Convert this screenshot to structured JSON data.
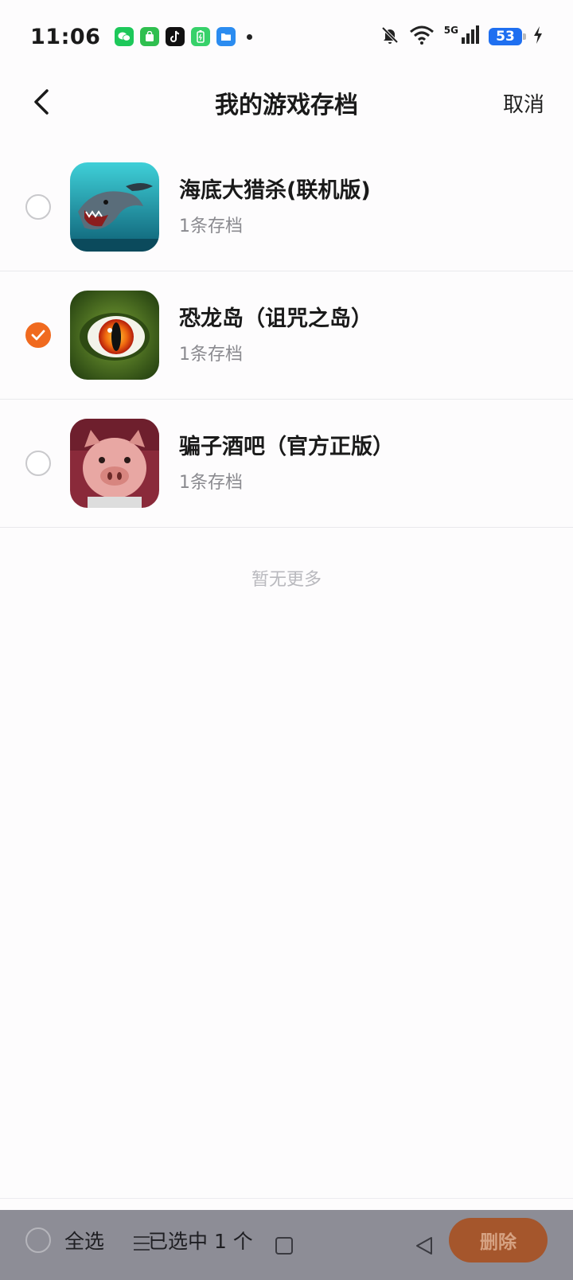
{
  "status": {
    "time": "11:06",
    "network_label": "5G",
    "battery_level": "53"
  },
  "header": {
    "title": "我的游戏存档",
    "cancel_label": "取消"
  },
  "games": [
    {
      "name": "海底大猎杀(联机版)",
      "saves": "1条存档",
      "checked": false
    },
    {
      "name": "恐龙岛（诅咒之岛）",
      "saves": "1条存档",
      "checked": true
    },
    {
      "name": "骗子酒吧（官方正版）",
      "saves": "1条存档",
      "checked": false
    }
  ],
  "list_footer": "暂无更多",
  "bottom_bar": {
    "select_all_label": "全选",
    "selected_count_label": "已选中 1 个",
    "delete_label": "删除"
  },
  "colors": {
    "accent": "#f06a1f",
    "delete_button": "#a5562c",
    "bottom_bar": "#8d8d96"
  }
}
